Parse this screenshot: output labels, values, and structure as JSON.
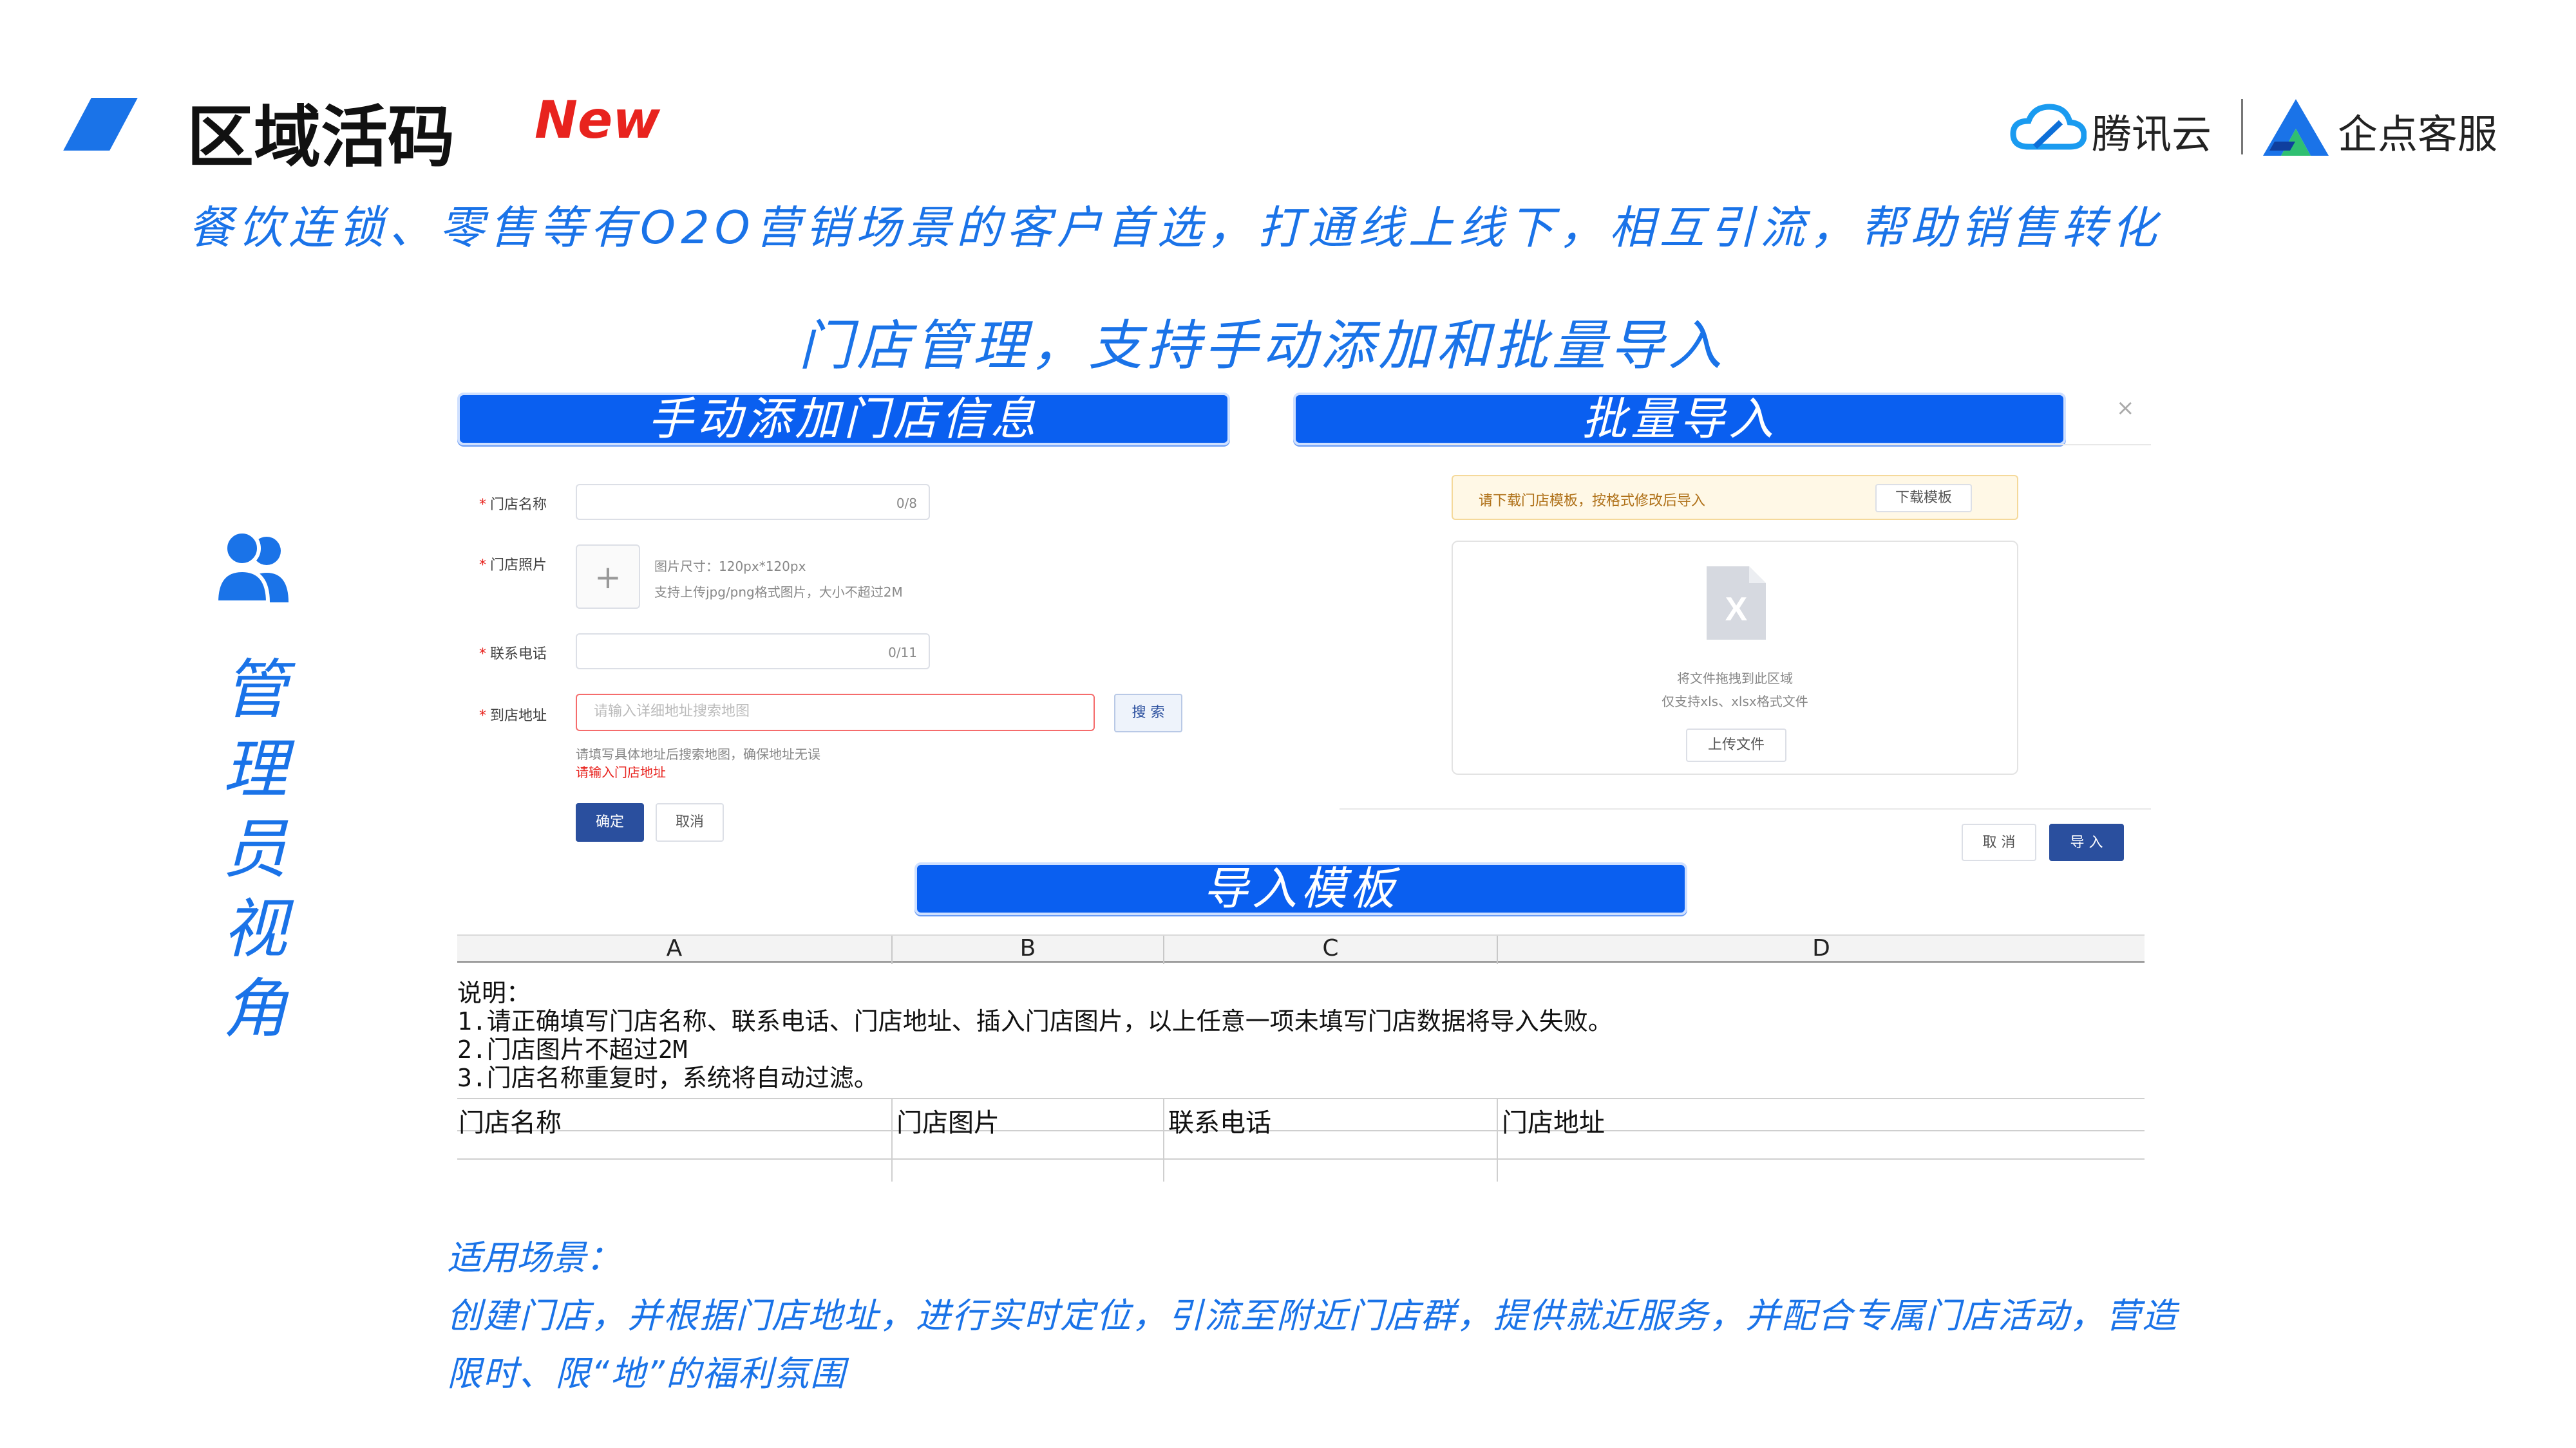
{
  "header": {
    "title": "区域活码",
    "badge": "New",
    "subtitle": "餐饮连锁、零售等有O2O营销场景的客户首选，打通线上线下，相互引流，帮助销售转化",
    "logos": {
      "tencent_cloud": "腾讯云",
      "qidian": "企点客服"
    }
  },
  "section_heading": "门店管理，支持手动添加和批量导入",
  "labels": {
    "manual": "手动添加门店信息",
    "batch": "批量导入",
    "template": "导入模板"
  },
  "sidebar": {
    "role_chars": [
      "管",
      "理",
      "员",
      "视",
      "角"
    ]
  },
  "manual_form": {
    "store_name": {
      "label": "门店名称",
      "counter": "0/8"
    },
    "store_photo": {
      "label": "门店照片",
      "plus": "+",
      "hint1": "图片尺寸：120px*120px",
      "hint2": "支持上传jpg/png格式图片，大小不超过2M"
    },
    "phone": {
      "label": "联系电话",
      "counter": "0/11"
    },
    "address": {
      "label": "到店地址",
      "placeholder": "请输入详细地址搜索地图",
      "search_button": "搜 索",
      "hint": "请填写具体地址后搜索地图，确保地址无误",
      "error": "请输入门店地址"
    },
    "confirm_button": "确定",
    "cancel_button": "取消"
  },
  "batch_import": {
    "close": "×",
    "notice": "请下载门店模板，按格式修改后导入",
    "download_button": "下载模板",
    "drop_line1": "将文件拖拽到此区域",
    "drop_line2": "仅支持xls、xlsx格式文件",
    "upload_button": "上传文件",
    "file_mark": "X",
    "cancel_button": "取 消",
    "import_button": "导 入"
  },
  "template_sheet": {
    "columns": [
      "A",
      "B",
      "C",
      "D"
    ],
    "notes": [
      "说明：",
      "1.请正确填写门店名称、联系电话、门店地址、插入门店图片，以上任意一项未填写门店数据将导入失败。",
      "2.门店图片不超过2M",
      "3.门店名称重复时，系统将自动过滤。"
    ],
    "headers": [
      "门店名称",
      "门店图片",
      "联系电话",
      "门店地址"
    ]
  },
  "scene": {
    "title": "适用场景：",
    "line1": "创建门店，并根据门店地址，进行实时定位，引流至附近门店群，提供就近服务，并配合专属门店活动，营造",
    "line2": "限时、限“地”的福利氛围"
  },
  "colors": {
    "accent": "#1a73e8",
    "bar": "#0a5ff0",
    "primary_button": "#2a4f9e",
    "error": "#e8231e"
  }
}
